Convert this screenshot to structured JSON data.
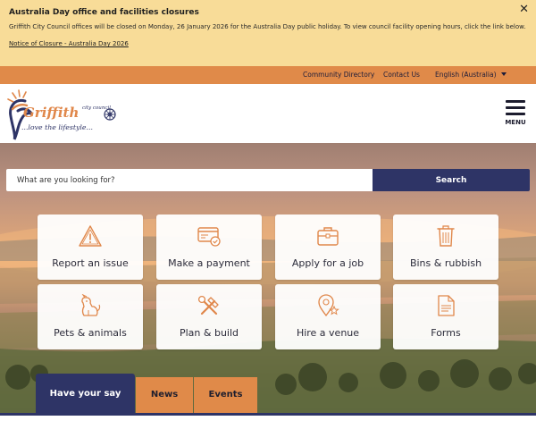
{
  "alert": {
    "title": "Australia Day office and facilities closures",
    "body": "Griffith City Council offices will be closed on Monday, 26 January 2026 for the Australia Day public holiday. To view council facility opening hours, click the link below.",
    "link": "Notice of Closure - Australia Day 2026",
    "close_glyph": "✕"
  },
  "utility": {
    "community_directory": "Community Directory",
    "contact_us": "Contact Us",
    "language": "English (Australia)"
  },
  "logo": {
    "wordmark": "Griffith",
    "subtitle": "city council",
    "tagline": "...love the lifestyle..."
  },
  "menu": {
    "label": "MENU"
  },
  "search": {
    "placeholder": "What are you looking for?",
    "button": "Search"
  },
  "tiles": [
    {
      "label": "Report an issue",
      "icon": "warning-icon"
    },
    {
      "label": "Make a payment",
      "icon": "credit-card-icon"
    },
    {
      "label": "Apply for a job",
      "icon": "briefcase-icon"
    },
    {
      "label": "Bins & rubbish",
      "icon": "trash-bin-icon"
    },
    {
      "label": "Pets & animals",
      "icon": "dog-icon"
    },
    {
      "label": "Plan & build",
      "icon": "hammer-wrench-icon"
    },
    {
      "label": "Hire a venue",
      "icon": "location-star-icon"
    },
    {
      "label": "Forms",
      "icon": "document-icon"
    }
  ],
  "tabs": [
    {
      "label": "Have your say",
      "active": true
    },
    {
      "label": "News",
      "active": false
    },
    {
      "label": "Events",
      "active": false
    }
  ],
  "colors": {
    "alert_bg": "#f8dc98",
    "accent_orange": "#e08a49",
    "navy": "#2e3466",
    "icon_orange": "#e0874a"
  }
}
